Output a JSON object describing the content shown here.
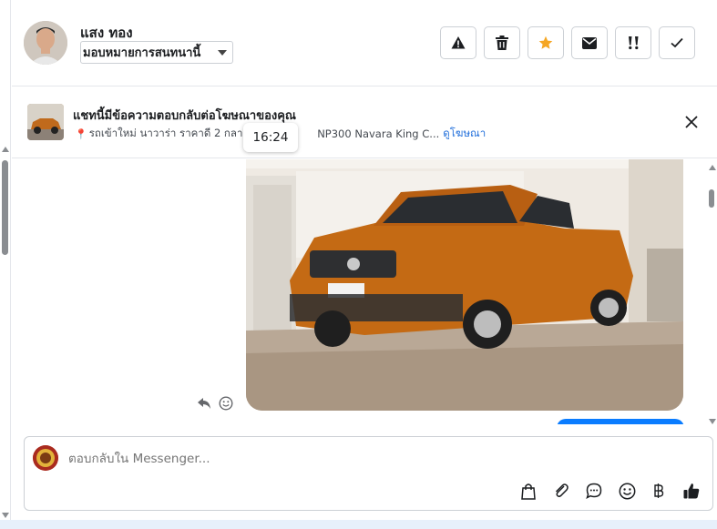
{
  "header": {
    "contact_name": "แสง ทอง",
    "assign_label": "มอบหมายการสนทนานี้",
    "actions": [
      {
        "name": "spam-icon",
        "color": "#1c1e21"
      },
      {
        "name": "trash-icon",
        "color": "#1c1e21"
      },
      {
        "name": "star-icon",
        "color": "#f5a623"
      },
      {
        "name": "mail-icon",
        "color": "#1c1e21"
      },
      {
        "name": "follow-up-icon",
        "color": "#1c1e21"
      },
      {
        "name": "check-icon",
        "color": "#1c1e21"
      }
    ]
  },
  "ad_banner": {
    "title": "แชทนี้มีข้อความตอบกลับต่อโฆษณาของคุณ",
    "subtitle": "รถเข้าใหม่ นาวาร่า ราคาดี 2 กลางๆ",
    "subtitle_tail": "NP300 Navara King C...",
    "link_label": "ดูโฆษณา",
    "tooltip_time": "16:24"
  },
  "composer": {
    "placeholder": "ตอบกลับใน Messenger..."
  },
  "colors": {
    "accent_blue": "#0a7cff",
    "link_blue": "#216fdb",
    "border": "#ccd0d5"
  }
}
